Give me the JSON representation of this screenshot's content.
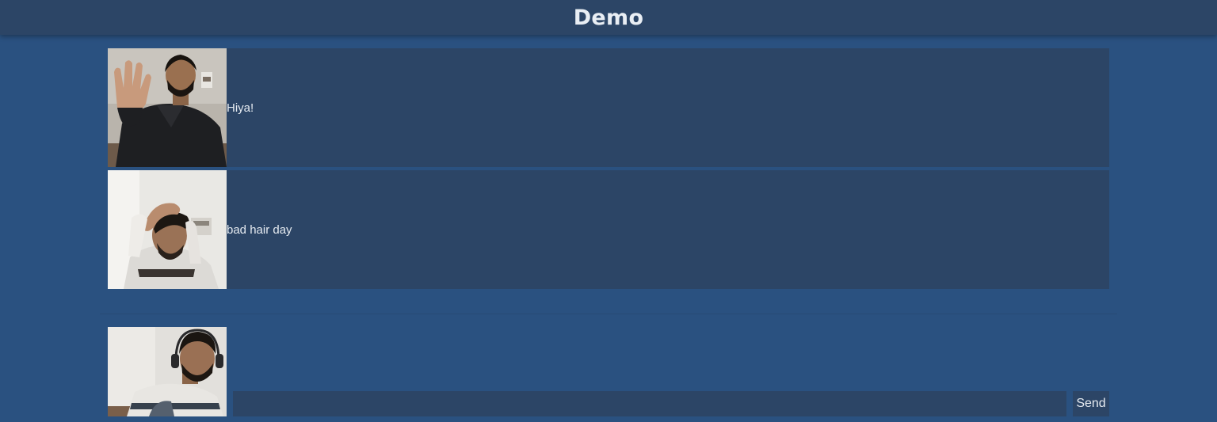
{
  "header": {
    "title": "Demo"
  },
  "messages": [
    {
      "text": "Hiya!",
      "thumbnail": "waving-person-video-frame"
    },
    {
      "text": "bad hair day",
      "thumbnail": "hand-in-hair-video-frame"
    }
  ],
  "composer": {
    "camera_preview": "webcam-preview-person-with-headphones",
    "input_value": "",
    "input_placeholder": "",
    "send_label": "Send"
  },
  "colors": {
    "background": "#2a5180",
    "panel": "#2c4566",
    "text": "#e6ebf1"
  }
}
